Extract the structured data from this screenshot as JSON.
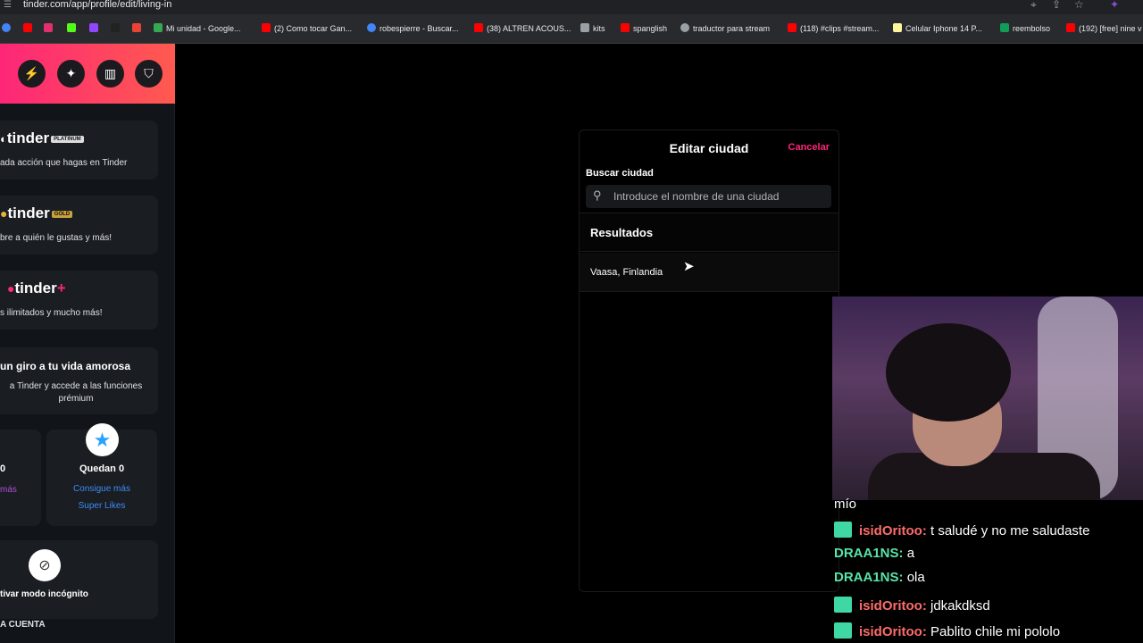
{
  "browser": {
    "url": "tinder.com/app/profile/edit/living-in",
    "bookmarks": [
      "Mi unidad - Google...",
      "(2) Como tocar Gan...",
      "robespierre - Buscar...",
      "(38) ALTREN ACOUS...",
      "kits",
      "spanglish",
      "traductor para stream",
      "(118) #clips #stream...",
      "Celular Iphone 14 P...",
      "reembolso",
      "(192) [free] nine v"
    ]
  },
  "sidebar": {
    "platinum": {
      "brand": "tinder",
      "badge": "PLATINUM",
      "sub": "ada acción que hagas en Tinder"
    },
    "gold": {
      "brand": "tinder",
      "badge": "GOLD",
      "sub": "bre a quién le gustas y más!"
    },
    "plus": {
      "brand": "tinder",
      "badge": "+",
      "sub": "s ilimitados y mucho más!"
    },
    "promo": {
      "title": "un giro a tu vida amorosa",
      "desc": "a Tinder y accede a las funciones prémium"
    },
    "boosts": {
      "count": "0",
      "link": "más"
    },
    "superlikes": {
      "count": "Quedan 0",
      "link1": "Consigue más",
      "link2": "Super Likes"
    },
    "incognito": {
      "label": "tivar modo incógnito"
    },
    "account_heading": "A CUENTA"
  },
  "modal": {
    "title": "Editar ciudad",
    "cancel": "Cancelar",
    "search_label": "Buscar ciudad",
    "search_placeholder": "Introduce el nombre de una ciudad",
    "results_heading": "Resultados",
    "results": [
      "Vaasa, Finlandia"
    ]
  },
  "chat": {
    "lines": [
      {
        "user": "",
        "text": "mío"
      },
      {
        "user": "isidOritoo:",
        "text": "t saludé y no me saludaste"
      },
      {
        "user": "DRAA1NS:",
        "text": "a"
      },
      {
        "user": "DRAA1NS:",
        "text": "ola"
      },
      {
        "user": "isidOritoo:",
        "text": "jdkakdksd"
      },
      {
        "user": "isidOritoo:",
        "text": "Pablito chile mi pololo"
      }
    ]
  }
}
